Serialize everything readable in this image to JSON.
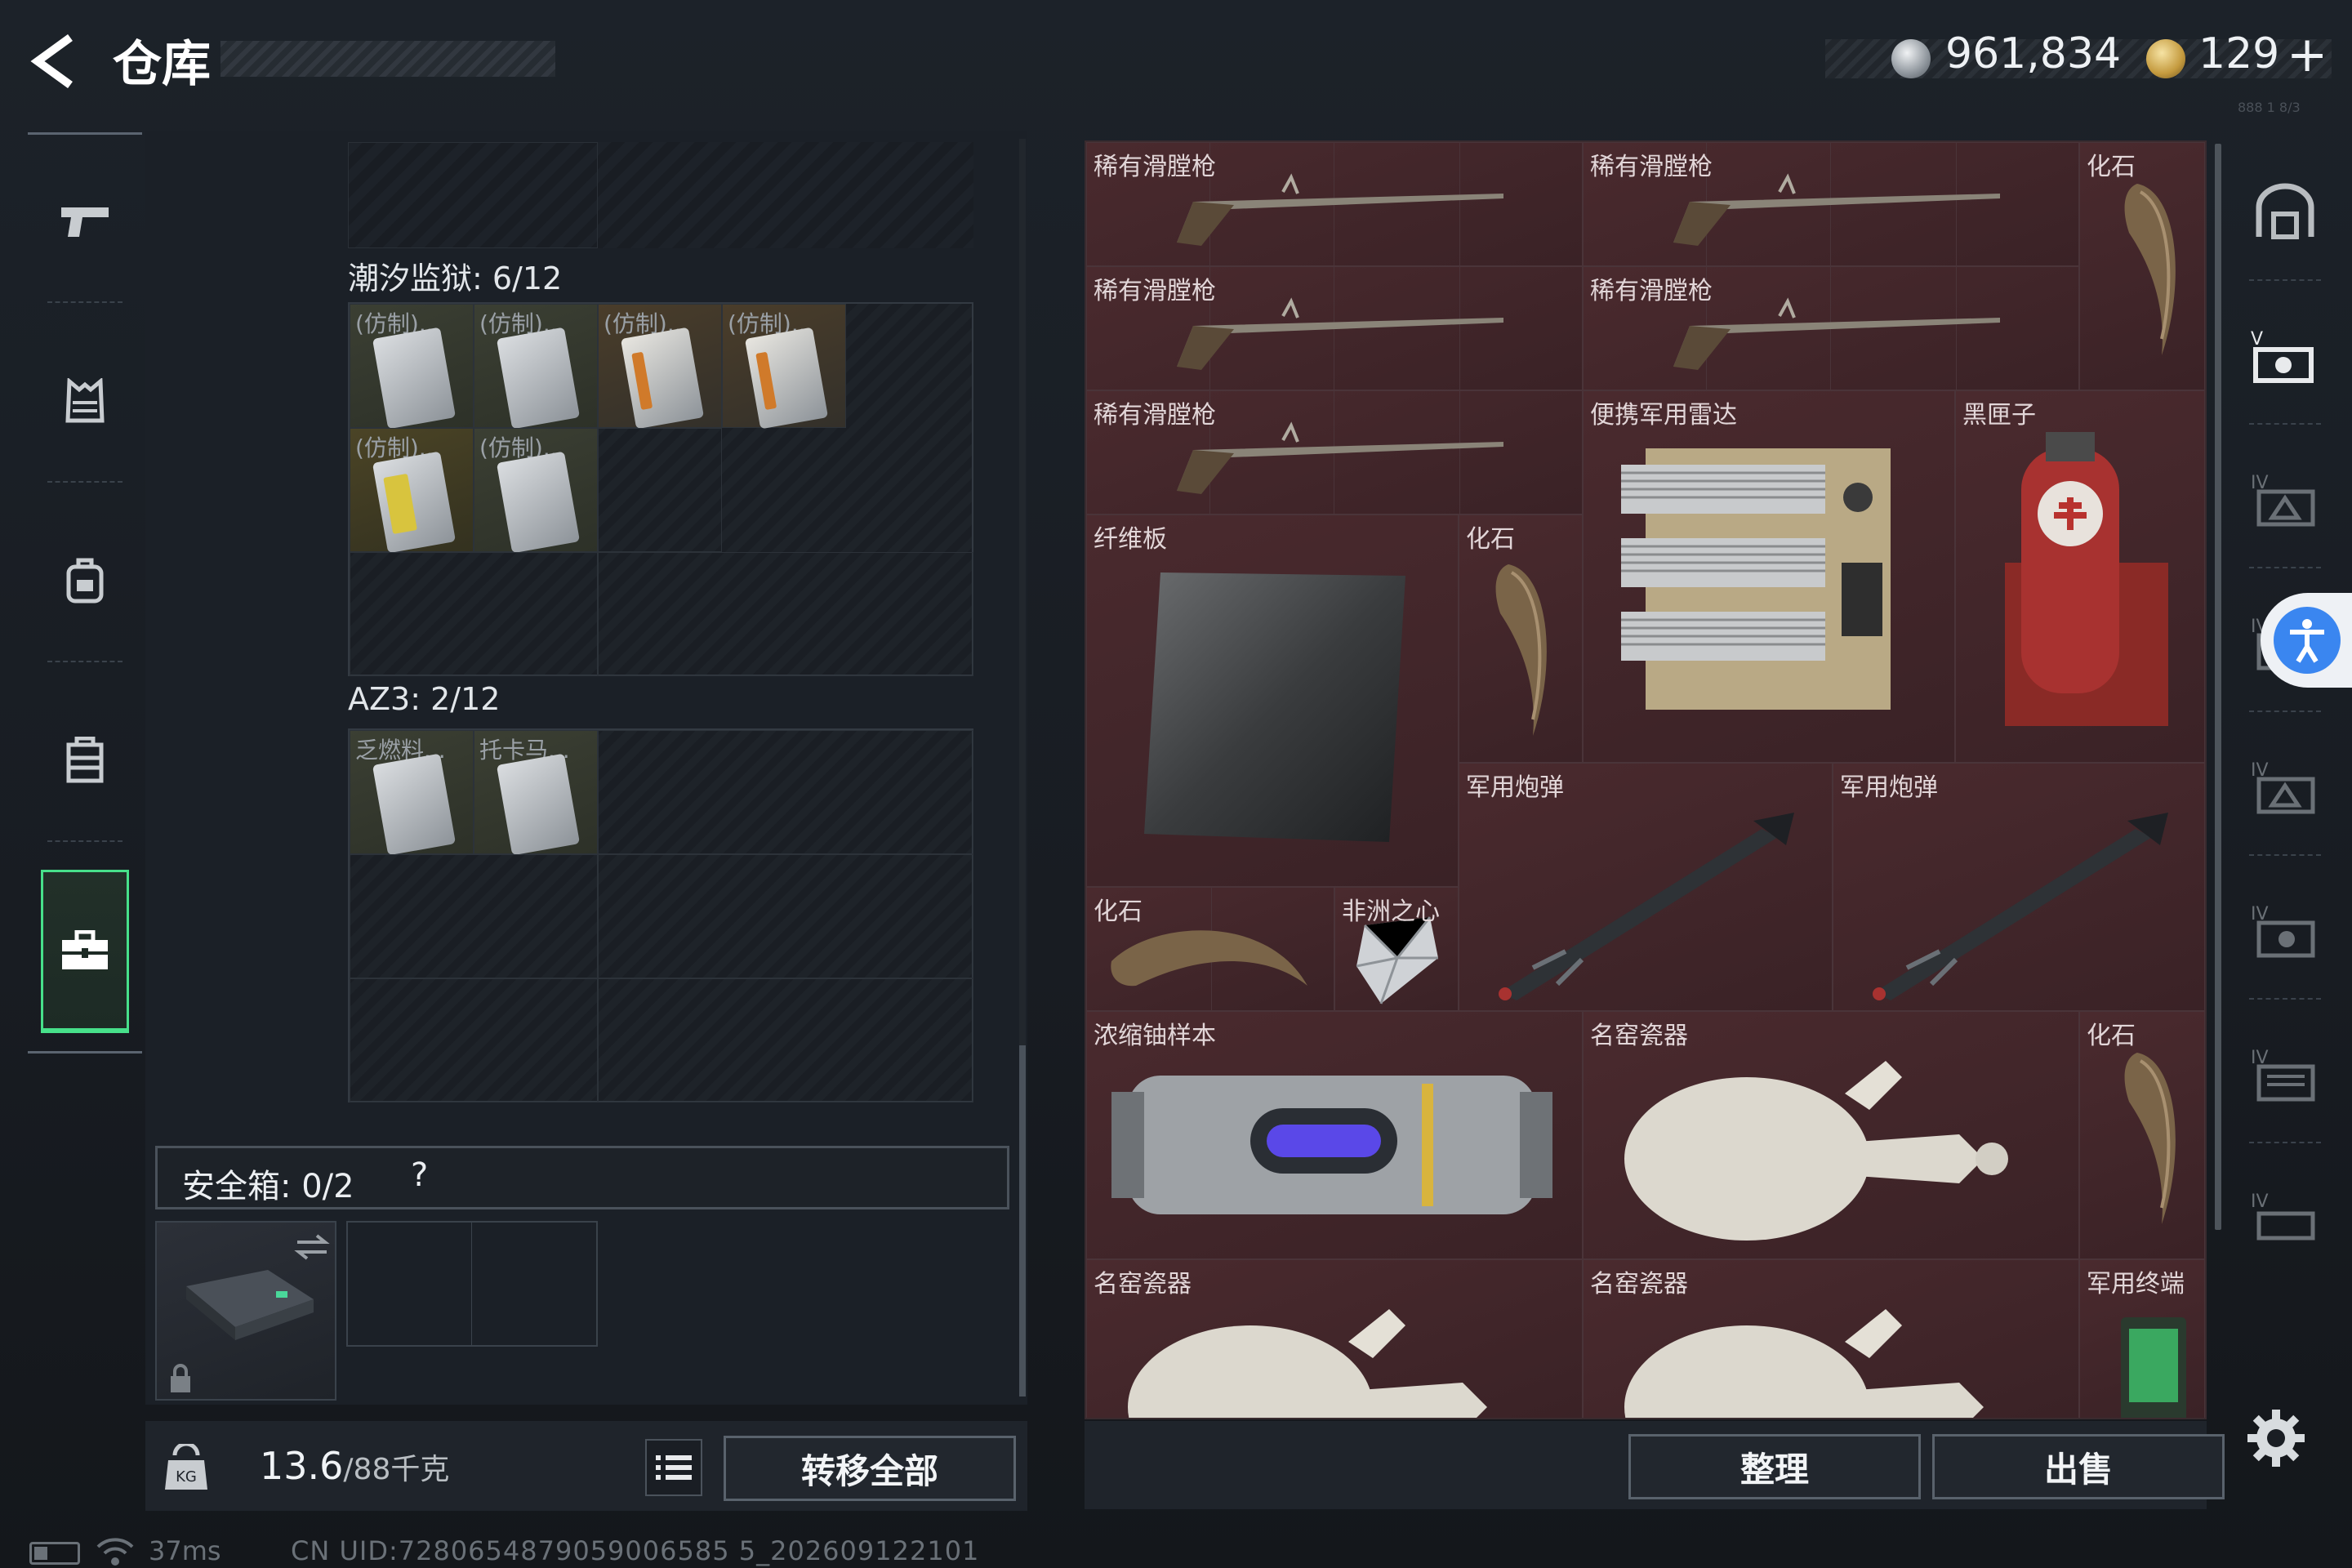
{
  "header": {
    "title": "仓库",
    "silver": "961,834",
    "gold": "129",
    "plus": "+",
    "version_mark": "888 1 8/3"
  },
  "left_nav": [
    {
      "name": "weapons",
      "icon": "pistol-icon"
    },
    {
      "name": "armor",
      "icon": "vest-icon"
    },
    {
      "name": "backpack",
      "icon": "backpack-icon"
    },
    {
      "name": "chest-rig",
      "icon": "rig-icon"
    },
    {
      "name": "stash",
      "icon": "toolbox-icon",
      "active": true
    }
  ],
  "stash": {
    "section1": {
      "label": "潮汐监狱: 6/12",
      "items": [
        "(仿制)...",
        "(仿制)...",
        "(仿制)...",
        "(仿制)...",
        "(仿制)...",
        "(仿制)..."
      ]
    },
    "section2": {
      "label": "AZ3: 2/12",
      "items": [
        "乏燃料...",
        "托卡马..."
      ]
    },
    "safebox": {
      "label": "安全箱: 0/2",
      "help": "?"
    },
    "weight": {
      "value": "13.6",
      "max": "/88千克"
    },
    "transfer_all": "转移全部"
  },
  "inventory": [
    {
      "id": "rare-musket-1",
      "label": "稀有滑膛枪"
    },
    {
      "id": "rare-musket-2",
      "label": "稀有滑膛枪"
    },
    {
      "id": "fossil-1",
      "label": "化石"
    },
    {
      "id": "rare-musket-3",
      "label": "稀有滑膛枪"
    },
    {
      "id": "rare-musket-4",
      "label": "稀有滑膛枪"
    },
    {
      "id": "rare-musket-5",
      "label": "稀有滑膛枪"
    },
    {
      "id": "portable-radar",
      "label": "便携军用雷达"
    },
    {
      "id": "black-box",
      "label": "黑匣子"
    },
    {
      "id": "fiber-board",
      "label": "纤维板"
    },
    {
      "id": "fossil-2",
      "label": "化石"
    },
    {
      "id": "artillery-shell-1",
      "label": "军用炮弹"
    },
    {
      "id": "artillery-shell-2",
      "label": "军用炮弹"
    },
    {
      "id": "fossil-3",
      "label": "化石"
    },
    {
      "id": "heart-of-africa",
      "label": "非洲之心"
    },
    {
      "id": "uranium-sample",
      "label": "浓缩铀样本"
    },
    {
      "id": "famous-porcelain-1",
      "label": "名窑瓷器"
    },
    {
      "id": "fossil-4",
      "label": "化石"
    },
    {
      "id": "famous-porcelain-2",
      "label": "名窑瓷器"
    },
    {
      "id": "famous-porcelain-3",
      "label": "名窑瓷器"
    },
    {
      "id": "military-terminal",
      "label": "军用终端"
    }
  ],
  "actions": {
    "sort": "整理",
    "sell": "出售"
  },
  "right_nav": [
    {
      "name": "stash-home",
      "label": ""
    },
    {
      "name": "page-5",
      "label": "V"
    },
    {
      "name": "page-4a",
      "label": "IV"
    },
    {
      "name": "page-4b",
      "label": "IV"
    },
    {
      "name": "page-4c",
      "label": "IV"
    },
    {
      "name": "page-4d",
      "label": "IV"
    },
    {
      "name": "page-4e",
      "label": "IV"
    },
    {
      "name": "page-4f",
      "label": "IV"
    }
  ],
  "status": {
    "ping": "37ms",
    "uid": "CN UID:7280654879059006585 5_202609122101"
  },
  "colors": {
    "accent_green": "#47e08a",
    "inventory_bg": "#3a2226",
    "access_blue": "#3a86f0"
  }
}
